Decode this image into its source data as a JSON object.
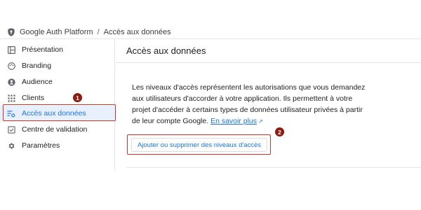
{
  "breadcrumb": {
    "app": "Google Auth Platform",
    "separator": "/",
    "current": "Accès aux données",
    "icon": "shield-icon"
  },
  "sidebar": {
    "items": [
      {
        "label": "Présentation",
        "icon": "dashboard-icon",
        "active": false
      },
      {
        "label": "Branding",
        "icon": "palette-icon",
        "active": false
      },
      {
        "label": "Audience",
        "icon": "account-circle-icon",
        "active": false
      },
      {
        "label": "Clients",
        "icon": "apps-grid-icon",
        "active": false
      },
      {
        "label": "Accès aux données",
        "icon": "data-access-icon",
        "active": true
      },
      {
        "label": "Centre de validation",
        "icon": "verification-icon",
        "active": false
      },
      {
        "label": "Paramètres",
        "icon": "gear-icon",
        "active": false
      }
    ]
  },
  "main": {
    "title": "Accès aux données",
    "description_lines": [
      "Les niveaux d'accès représentent les autorisations que vous demandez",
      "aux utilisateurs d'accorder à votre application. Ils permettent à votre",
      "projet d'accéder à certains types de données utilisateur privées à partir",
      "de leur compte Google."
    ],
    "learn_more": "En savoir plus",
    "action_button": "Ajouter ou supprimer des niveaux d'accès"
  },
  "annotations": {
    "step1": "1",
    "step2": "2",
    "highlight_color": "#d93025",
    "badge_color": "#8e1b12"
  },
  "colors": {
    "accent": "#1a73e8",
    "active_bg": "#e8f0fe"
  }
}
